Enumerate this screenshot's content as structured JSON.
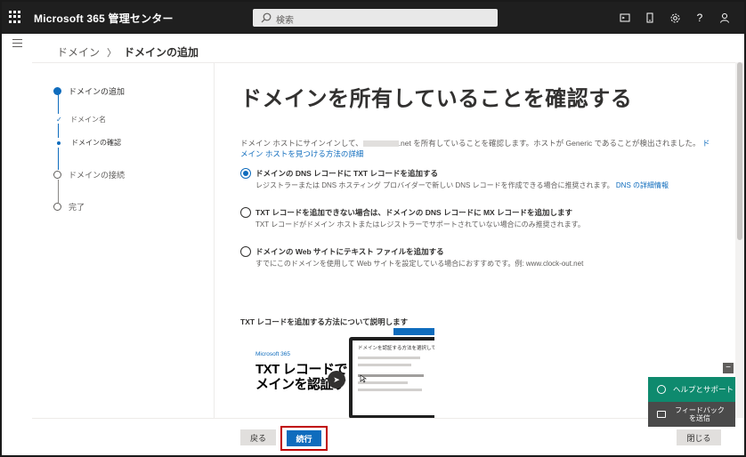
{
  "app": {
    "title": "Microsoft 365 管理センター"
  },
  "search": {
    "placeholder": "検索"
  },
  "topbar_icons": [
    "terminal-icon",
    "mobile-icon",
    "gear-icon",
    "help-icon",
    "user-icon"
  ],
  "breadcrumb": {
    "parent": "ドメイン",
    "separator": "〉",
    "current": "ドメインの追加"
  },
  "steps": {
    "step1": "ドメインの追加",
    "sub1": "ドメイン名",
    "sub2": "ドメインの確認",
    "step2": "ドメインの接続",
    "step3": "完了"
  },
  "main": {
    "heading": "ドメインを所有していることを確認する",
    "desc_part1": "ドメイン ホストにサインインして、",
    "desc_part2": ".net を所有していることを確認します。ホストが Generic であることが検出されました。",
    "desc_link": "ドメイン ホストを見つける方法の詳細"
  },
  "options": [
    {
      "title": "ドメインの DNS レコードに TXT レコードを追加する",
      "desc": "レジストラーまたは DNS ホスティング プロバイダーで新しい DNS レコードを作成できる場合に推奨されます。",
      "link": "DNS の詳細情報",
      "selected": true
    },
    {
      "title": "TXT レコードを追加できない場合は、ドメインの DNS レコードに MX レコードを追加します",
      "desc": "TXT レコードがドメイン ホストまたはレジストラーでサポートされていない場合にのみ推奨されます。",
      "selected": false
    },
    {
      "title": "ドメインの Web サイトにテキスト ファイルを追加する",
      "desc": "すでにこのドメインを使用して Web サイトを設定している場合におすすめです。例: www.clock-out.net",
      "selected": false
    }
  ],
  "video": {
    "heading": "TXT レコードを追加する方法について説明します",
    "brand": "Microsoft 365",
    "title_line1": "TXT レコードでド",
    "title_line2": "メインを認証す",
    "screen_title": "ドメインを認証する方法を選択してく"
  },
  "footer": {
    "back": "戻る",
    "next": "続行",
    "close": "閉じる"
  },
  "help": {
    "minimize": "−",
    "help_support": "ヘルプとサポート",
    "feedback_line1": "フィードバック",
    "feedback_line2": "を送信"
  },
  "colors": {
    "topbar": "#1f1f1f",
    "accent": "#0f6cbd",
    "help_green": "#0e8a6e",
    "highlight_box": "#c00000"
  }
}
